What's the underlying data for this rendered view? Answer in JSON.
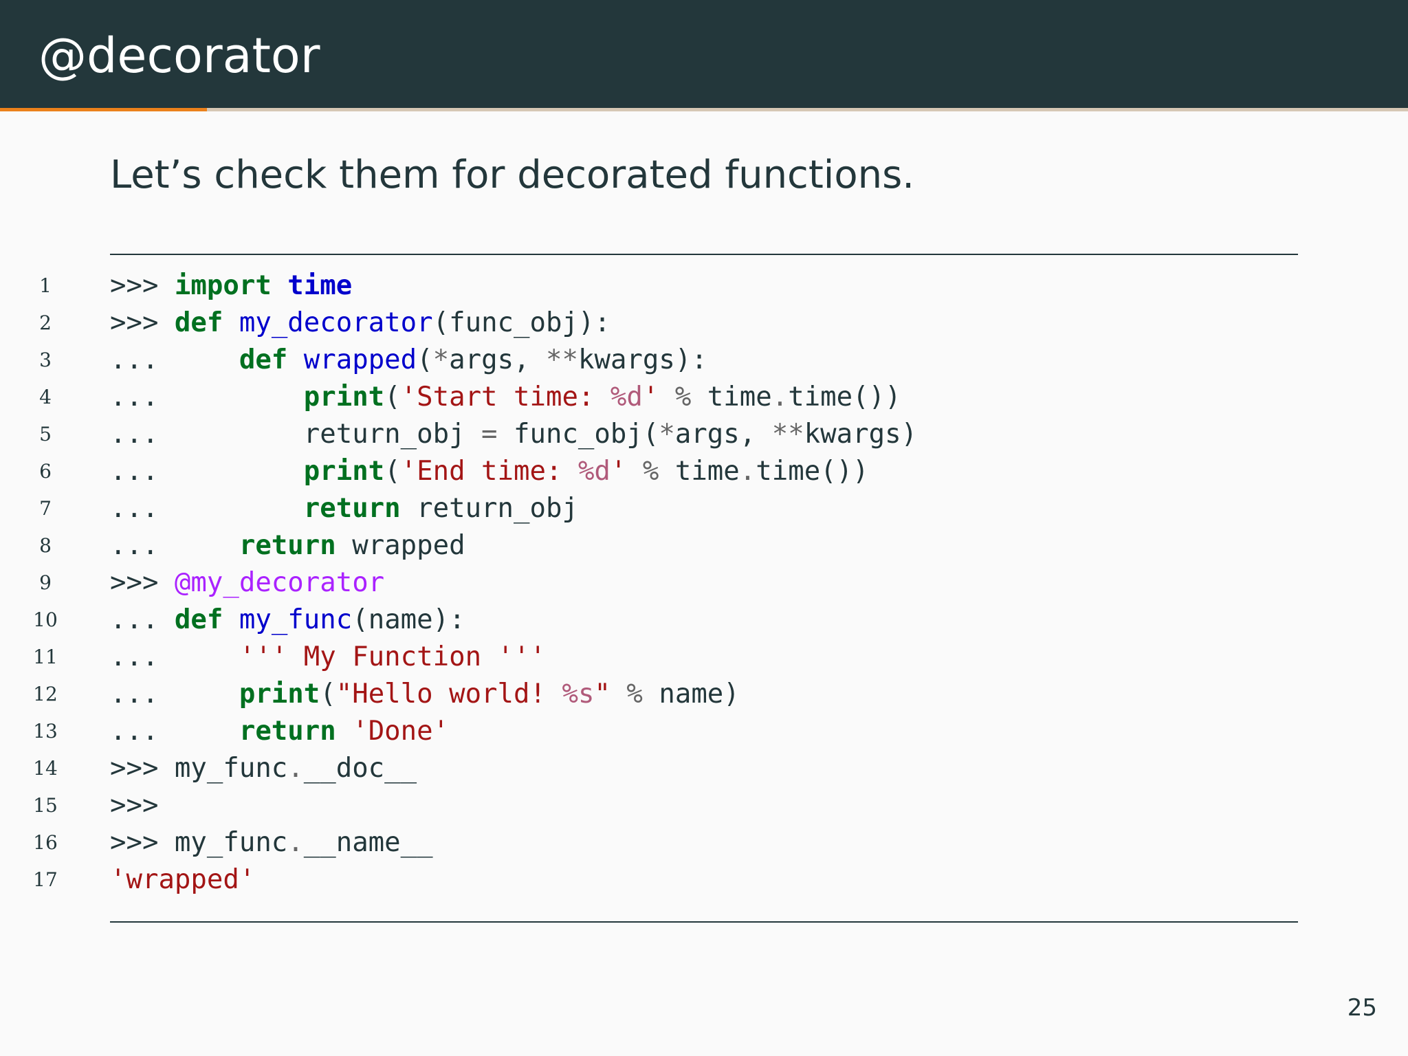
{
  "slide": {
    "title": "@decorator",
    "subtitle": "Let’s check them for decorated functions.",
    "page_number": "25",
    "progress_fraction": 0.147
  },
  "colors": {
    "header_bg": "#23373b",
    "accent": "#eb811b",
    "progress_track": "#d6c7b4",
    "background": "#fafafa",
    "keyword": "#007020",
    "function_name": "#0000cc",
    "string": "#a31515",
    "format_spec": "#b05a7a",
    "decorator": "#aa22ff"
  },
  "code": {
    "language": "python",
    "lines": [
      {
        "number": "1",
        "tokens": [
          {
            "text": ">>> ",
            "kind": "txt"
          },
          {
            "text": "import",
            "kind": "kw"
          },
          {
            "text": " ",
            "kind": "txt"
          },
          {
            "text": "time",
            "kind": "nm"
          }
        ]
      },
      {
        "number": "2",
        "tokens": [
          {
            "text": ">>> ",
            "kind": "txt"
          },
          {
            "text": "def",
            "kind": "kw"
          },
          {
            "text": " ",
            "kind": "txt"
          },
          {
            "text": "my_decorator",
            "kind": "fn"
          },
          {
            "text": "(func_obj):",
            "kind": "txt"
          }
        ]
      },
      {
        "number": "3",
        "tokens": [
          {
            "text": "...     ",
            "kind": "txt"
          },
          {
            "text": "def",
            "kind": "kw"
          },
          {
            "text": " ",
            "kind": "txt"
          },
          {
            "text": "wrapped",
            "kind": "fn"
          },
          {
            "text": "(",
            "kind": "txt"
          },
          {
            "text": "*",
            "kind": "op"
          },
          {
            "text": "args, ",
            "kind": "txt"
          },
          {
            "text": "**",
            "kind": "op"
          },
          {
            "text": "kwargs):",
            "kind": "txt"
          }
        ]
      },
      {
        "number": "4",
        "tokens": [
          {
            "text": "...         ",
            "kind": "txt"
          },
          {
            "text": "print",
            "kind": "kw"
          },
          {
            "text": "(",
            "kind": "txt"
          },
          {
            "text": "'Start time: ",
            "kind": "str"
          },
          {
            "text": "%d",
            "kind": "fmt"
          },
          {
            "text": "'",
            "kind": "str"
          },
          {
            "text": " ",
            "kind": "txt"
          },
          {
            "text": "%",
            "kind": "op"
          },
          {
            "text": " time",
            "kind": "txt"
          },
          {
            "text": ".",
            "kind": "op"
          },
          {
            "text": "time())",
            "kind": "txt"
          }
        ]
      },
      {
        "number": "5",
        "tokens": [
          {
            "text": "...         return_obj ",
            "kind": "txt"
          },
          {
            "text": "=",
            "kind": "op"
          },
          {
            "text": " func_obj(",
            "kind": "txt"
          },
          {
            "text": "*",
            "kind": "op"
          },
          {
            "text": "args, ",
            "kind": "txt"
          },
          {
            "text": "**",
            "kind": "op"
          },
          {
            "text": "kwargs)",
            "kind": "txt"
          }
        ]
      },
      {
        "number": "6",
        "tokens": [
          {
            "text": "...         ",
            "kind": "txt"
          },
          {
            "text": "print",
            "kind": "kw"
          },
          {
            "text": "(",
            "kind": "txt"
          },
          {
            "text": "'End time: ",
            "kind": "str"
          },
          {
            "text": "%d",
            "kind": "fmt"
          },
          {
            "text": "'",
            "kind": "str"
          },
          {
            "text": " ",
            "kind": "txt"
          },
          {
            "text": "%",
            "kind": "op"
          },
          {
            "text": " time",
            "kind": "txt"
          },
          {
            "text": ".",
            "kind": "op"
          },
          {
            "text": "time())",
            "kind": "txt"
          }
        ]
      },
      {
        "number": "7",
        "tokens": [
          {
            "text": "...         ",
            "kind": "txt"
          },
          {
            "text": "return",
            "kind": "kw"
          },
          {
            "text": " return_obj",
            "kind": "txt"
          }
        ]
      },
      {
        "number": "8",
        "tokens": [
          {
            "text": "...     ",
            "kind": "txt"
          },
          {
            "text": "return",
            "kind": "kw"
          },
          {
            "text": " wrapped",
            "kind": "txt"
          }
        ]
      },
      {
        "number": "9",
        "tokens": [
          {
            "text": ">>> ",
            "kind": "txt"
          },
          {
            "text": "@my_decorator",
            "kind": "dec"
          }
        ]
      },
      {
        "number": "10",
        "tokens": [
          {
            "text": "... ",
            "kind": "txt"
          },
          {
            "text": "def",
            "kind": "kw"
          },
          {
            "text": " ",
            "kind": "txt"
          },
          {
            "text": "my_func",
            "kind": "fn"
          },
          {
            "text": "(name):",
            "kind": "txt"
          }
        ]
      },
      {
        "number": "11",
        "tokens": [
          {
            "text": "...     ",
            "kind": "txt"
          },
          {
            "text": "''' My Function '''",
            "kind": "str"
          }
        ]
      },
      {
        "number": "12",
        "tokens": [
          {
            "text": "...     ",
            "kind": "txt"
          },
          {
            "text": "print",
            "kind": "kw"
          },
          {
            "text": "(",
            "kind": "txt"
          },
          {
            "text": "\"Hello world! ",
            "kind": "str"
          },
          {
            "text": "%s",
            "kind": "fmt"
          },
          {
            "text": "\"",
            "kind": "str"
          },
          {
            "text": " ",
            "kind": "txt"
          },
          {
            "text": "%",
            "kind": "op"
          },
          {
            "text": " name)",
            "kind": "txt"
          }
        ]
      },
      {
        "number": "13",
        "tokens": [
          {
            "text": "...     ",
            "kind": "txt"
          },
          {
            "text": "return",
            "kind": "kw"
          },
          {
            "text": " ",
            "kind": "txt"
          },
          {
            "text": "'Done'",
            "kind": "str"
          }
        ]
      },
      {
        "number": "14",
        "tokens": [
          {
            "text": ">>> my_func",
            "kind": "txt"
          },
          {
            "text": ".",
            "kind": "op"
          },
          {
            "text": "__doc__",
            "kind": "txt"
          }
        ]
      },
      {
        "number": "15",
        "tokens": [
          {
            "text": ">>>",
            "kind": "txt"
          }
        ]
      },
      {
        "number": "16",
        "tokens": [
          {
            "text": ">>> my_func",
            "kind": "txt"
          },
          {
            "text": ".",
            "kind": "op"
          },
          {
            "text": "__name__",
            "kind": "txt"
          }
        ]
      },
      {
        "number": "17",
        "tokens": [
          {
            "text": "'wrapped'",
            "kind": "str"
          }
        ]
      }
    ]
  }
}
